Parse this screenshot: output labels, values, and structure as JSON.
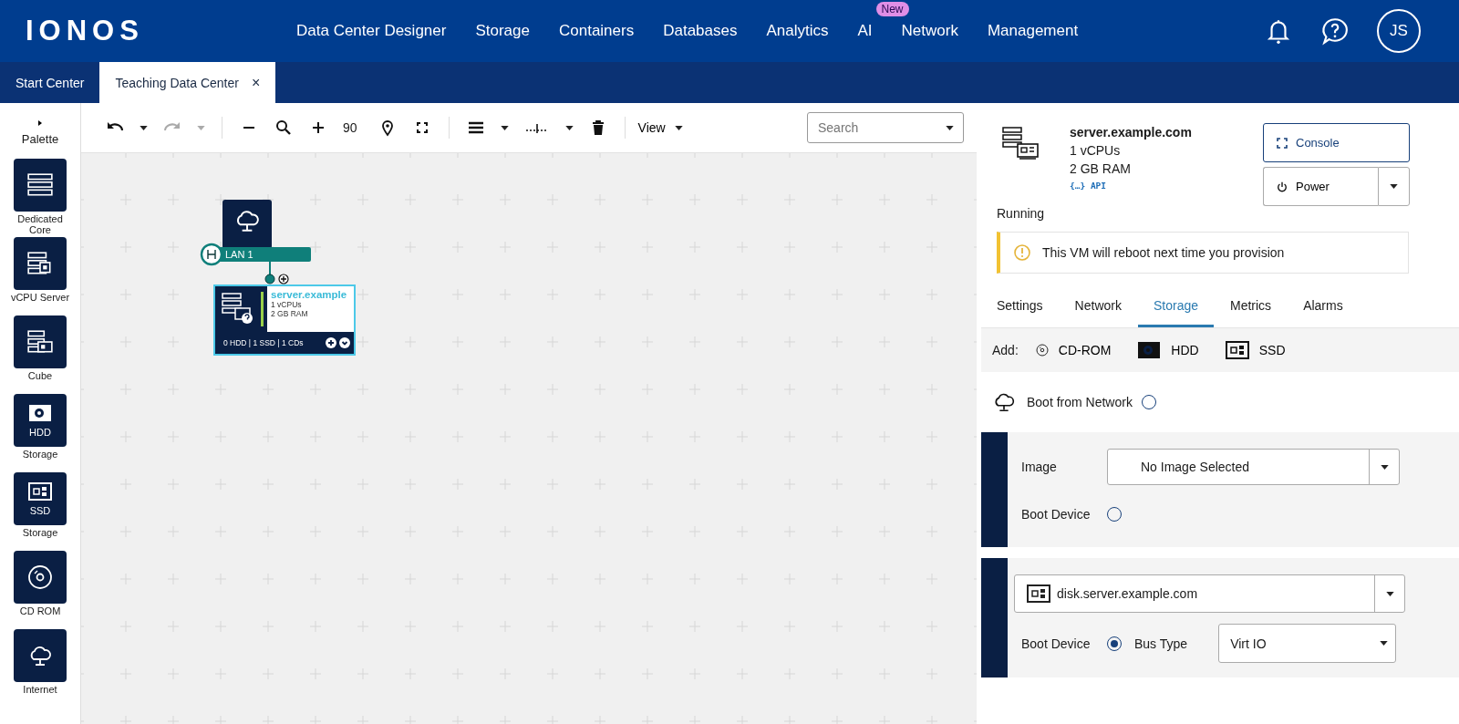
{
  "header": {
    "logo": "IONOS",
    "nav": [
      {
        "label": "Data Center Designer"
      },
      {
        "label": "Storage"
      },
      {
        "label": "Containers"
      },
      {
        "label": "Databases"
      },
      {
        "label": "Analytics"
      },
      {
        "label": "AI",
        "badge": "New"
      },
      {
        "label": "Network"
      },
      {
        "label": "Management"
      }
    ],
    "avatar": "JS"
  },
  "tabs": [
    {
      "label": "Start Center",
      "selected": false,
      "closable": false
    },
    {
      "label": "Teaching Data Center",
      "selected": true,
      "closable": true,
      "close": "×"
    }
  ],
  "palette": {
    "title": "Palette",
    "items": [
      {
        "kind": "dedicated",
        "label": "Dedicated Core"
      },
      {
        "kind": "vcpu",
        "label": "vCPU Server"
      },
      {
        "kind": "cube",
        "label": "Cube"
      },
      {
        "kind": "hdd",
        "tile_text": "HDD",
        "label": "Storage"
      },
      {
        "kind": "ssd",
        "tile_text": "SSD",
        "label": "Storage"
      },
      {
        "kind": "cd",
        "label": "CD ROM"
      },
      {
        "kind": "internet",
        "label": "Internet"
      }
    ]
  },
  "toolbar": {
    "zoom": "90",
    "view": "View",
    "search": {
      "placeholder": "Search"
    }
  },
  "canvas": {
    "lan": {
      "label": "LAN 1"
    },
    "server": {
      "name": "server.example",
      "cpus": "1 vCPUs",
      "ram": "2 GB RAM",
      "storage": "0 HDD | 1 SSD | 1 CDs"
    }
  },
  "details": {
    "name": "server.example.com",
    "cpus": "1 vCPUs",
    "ram": "2 GB RAM",
    "api": "{…} API",
    "status": "Running",
    "console": "Console",
    "power": "Power",
    "warning": "This VM will reboot next time you provision",
    "tabs": [
      {
        "label": "Settings",
        "selected": false
      },
      {
        "label": "Network",
        "selected": false
      },
      {
        "label": "Storage",
        "selected": true
      },
      {
        "label": "Metrics",
        "selected": false
      },
      {
        "label": "Alarms",
        "selected": false
      }
    ],
    "add": {
      "label": "Add:",
      "items": [
        {
          "kind": "cd",
          "label": "CD-ROM"
        },
        {
          "kind": "hdd",
          "label": "HDD"
        },
        {
          "kind": "ssd",
          "label": "SSD"
        }
      ]
    },
    "boot_from_network": {
      "label": "Boot from Network",
      "selected": false
    },
    "volumes": [
      {
        "kind": "image",
        "image_label": "Image",
        "image_value": "No Image Selected",
        "boot_label": "Boot Device",
        "boot_selected": false
      },
      {
        "kind": "disk",
        "disk": "disk.server.example.com",
        "boot_label": "Boot Device",
        "boot_selected": true,
        "bus_label": "Bus Type",
        "bus_value": "Virt IO"
      }
    ]
  }
}
